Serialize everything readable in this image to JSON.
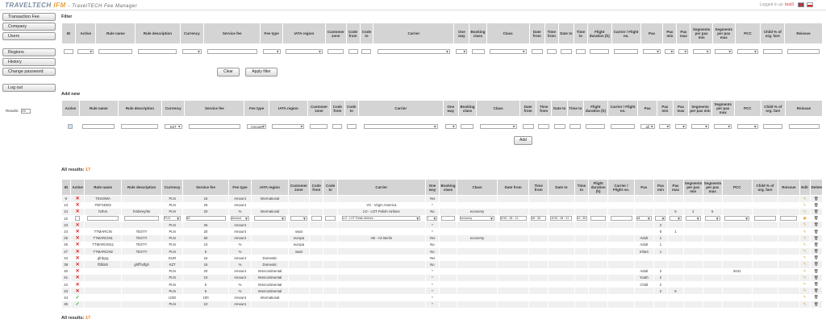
{
  "header": {
    "logo_main": "TRAVELTECH",
    "logo_accent": "IFM",
    "logo_sub": "- TravelTECH Fee Manager",
    "login_label": "Logged in as:",
    "login_user": "test3"
  },
  "sidebar": {
    "items": [
      "Transaction Fee",
      "Company",
      "Users",
      "Regions",
      "History",
      "Change password",
      "Log out"
    ],
    "results_label": "Results:",
    "results_value": "25"
  },
  "filter": {
    "title": "Filter",
    "columns": [
      "ID",
      "Active",
      "Rule name",
      "Rule description",
      "Currency",
      "Service fee",
      "Fee type",
      "IATA region",
      "Customer zone",
      "Code from",
      "Code to",
      "Carrier",
      "One way",
      "Booking class",
      "Class",
      "Date from",
      "Time from",
      "Date to",
      "Time to",
      "Flight duration (h)",
      "Carrier / Flight no.",
      "Pax",
      "Pax min",
      "Pax max",
      "Segments per pax min",
      "Segments per pax max",
      "PCC",
      "Child % of org. fare",
      "Reissue"
    ],
    "clear_label": "Clear",
    "apply_label": "Apply filter"
  },
  "addnew": {
    "title": "Add new",
    "columns": [
      "Active",
      "Rule name",
      "Rule description",
      "Currency",
      "Service fee",
      "Fee type",
      "IATA region",
      "Customer zone",
      "Code from",
      "Code to",
      "Carrier",
      "One way",
      "Booking class",
      "Class",
      "Date from",
      "Time from",
      "Date to",
      "Time to",
      "Flight duration (h)",
      "Carrier / Flight no.",
      "Pax",
      "Pax min",
      "Pax max",
      "Segments per pax min",
      "Segments per pax max",
      "PCC",
      "Child % of org. fare",
      "Reissue"
    ],
    "currency": "KZT",
    "feetype": "Amount",
    "pax": "all",
    "add_label": "Add"
  },
  "results": {
    "label": "All results:",
    "count": "17",
    "columns": [
      "ID",
      "Active",
      "Rule name",
      "Rule description",
      "Currency",
      "Service fee",
      "Fee type",
      "IATA region",
      "Customer zone",
      "Code from",
      "Code to",
      "Carrier",
      "One way",
      "Booking class",
      "Class",
      "Date from",
      "Time from",
      "Date to",
      "Time to",
      "Flight duration (h)",
      "Carrier / Flight no.",
      "Pax",
      "Pax min",
      "Pax max",
      "Segments per pax min",
      "Segments per pax max",
      "PCC",
      "Child % of org. fare",
      "Reissue",
      "Edit",
      "Delete"
    ],
    "rows": [
      {
        "id": "9",
        "active": "x",
        "name": "TESOWA",
        "desc": "",
        "cur": "PLN",
        "fee": "15",
        "type": "Amount",
        "iata": "International",
        "zone": "",
        "carrier": "",
        "oneway": "Yes",
        "cls": "",
        "pax": "",
        "pmin": "",
        "pmax": "",
        "smin": "",
        "smax": "",
        "pcc": ""
      },
      {
        "id": "13",
        "active": "x",
        "name": "FDFSDDS",
        "desc": "",
        "cur": "PLN",
        "fee": "26",
        "type": "Amount",
        "iata": "",
        "zone": "",
        "carrier": "VX - Virgin America",
        "oneway": "*",
        "cls": "",
        "pax": "",
        "pmin": "",
        "pmax": "",
        "smin": "",
        "smax": "",
        "pcc": ""
      },
      {
        "id": "14",
        "active": "x",
        "name": "hrthrs",
        "desc": "hrtdsreyhts",
        "cur": "PLN",
        "fee": "20",
        "type": "%",
        "iata": "International",
        "zone": "",
        "carrier": "LO - LOT Polish Airlines",
        "oneway": "No",
        "cls": "economy",
        "pax": "",
        "pmin": "",
        "pmax": "6",
        "smin": "2",
        "smax": "5",
        "pcc": ""
      },
      {
        "id": "22",
        "edit": true,
        "cur": "PLN",
        "fee": "45",
        "type": "Amount",
        "carrier": "LO - LOT Polish Airlines",
        "oneway": "*",
        "cls": "economy",
        "df": "2015 - 08 - 12",
        "tf": "08 : 35",
        "dt": "2015 - 08 - 31",
        "tt": "12 : 35",
        "pax": "all"
      },
      {
        "id": "23",
        "active": "x",
        "name": "",
        "desc": "",
        "cur": "PLN",
        "fee": "25",
        "type": "Amount",
        "iata": "",
        "zone": "",
        "carrier": "",
        "oneway": "*",
        "cls": "",
        "pax": "",
        "pmin": "2",
        "pmax": "",
        "smin": "",
        "smax": "",
        "pcc": ""
      },
      {
        "id": "24",
        "active": "x",
        "name": "TTMARCIN",
        "desc": "TESTY",
        "cur": "PLN",
        "fee": "20",
        "type": "Amount",
        "iata": "",
        "zone": "swat",
        "carrier": "",
        "oneway": "*",
        "cls": "",
        "pax": "",
        "pmin": "0",
        "pmax": "1",
        "smin": "",
        "smax": "",
        "pcc": ""
      },
      {
        "id": "25",
        "active": "x",
        "name": "TTMARCIN1",
        "desc": "TESTY",
        "cur": "PLN",
        "fee": "50",
        "type": "Amount",
        "iata": "",
        "zone": "europa",
        "carrier": "AB - Air Berlin",
        "oneway": "Yes",
        "cls": "economy",
        "pax": "Adult",
        "pmin": "1",
        "pmax": "",
        "smin": "",
        "smax": "",
        "pcc": ""
      },
      {
        "id": "26",
        "active": "x",
        "name": "TTMARCIN11",
        "desc": "TESTY",
        "cur": "PLN",
        "fee": "10",
        "type": "%",
        "iata": "",
        "zone": "europa",
        "carrier": "",
        "oneway": "No",
        "cls": "",
        "pax": "Adult",
        "pmin": "1",
        "pmax": "",
        "smin": "",
        "smax": "",
        "pcc": ""
      },
      {
        "id": "27",
        "active": "x",
        "name": "TTMARCIN2",
        "desc": "TESTY",
        "cur": "PLN",
        "fee": "6",
        "type": "%",
        "iata": "",
        "zone": "swat",
        "carrier": "",
        "oneway": "No",
        "cls": "",
        "pax": "Infant",
        "pmin": "1",
        "pmax": "",
        "smin": "",
        "smax": "",
        "pcc": ""
      },
      {
        "id": "34",
        "active": "x",
        "name": "gfrdgrg",
        "desc": "",
        "cur": "EUR",
        "fee": "16",
        "type": "Amount",
        "iata": "Domestic",
        "zone": "",
        "carrier": "",
        "oneway": "Yes",
        "cls": "",
        "pax": "",
        "pmin": "",
        "pmax": "",
        "smin": "",
        "smax": "",
        "pcc": ""
      },
      {
        "id": "39",
        "active": "x",
        "name": "ffdfdsh",
        "desc": "ghff'hdfgh",
        "cur": "KZT",
        "fee": "15",
        "type": "%",
        "iata": "Domestic",
        "zone": "",
        "carrier": "",
        "oneway": "No",
        "cls": "",
        "pax": "",
        "pmin": "",
        "pmax": "",
        "smin": "",
        "smax": "",
        "pcc": ""
      },
      {
        "id": "40",
        "active": "x",
        "name": "",
        "desc": "",
        "cur": "PLN",
        "fee": "20",
        "type": "Amount",
        "iata": "Intercontinental",
        "zone": "",
        "carrier": "",
        "oneway": "*",
        "cls": "",
        "pax": "Adult",
        "pmin": "2",
        "pmax": "",
        "smin": "",
        "smax": "",
        "pcc": "3431"
      },
      {
        "id": "41",
        "active": "x",
        "name": "",
        "desc": "",
        "cur": "PLN",
        "fee": "10",
        "type": "Amount",
        "iata": "Intercontinental",
        "zone": "",
        "carrier": "",
        "oneway": "*",
        "cls": "",
        "pax": "Youth",
        "pmin": "2",
        "pmax": "",
        "smin": "",
        "smax": "",
        "pcc": ""
      },
      {
        "id": "42",
        "active": "x",
        "name": "",
        "desc": "",
        "cur": "PLN",
        "fee": "5",
        "type": "%",
        "iata": "Intercontinental",
        "zone": "",
        "carrier": "",
        "oneway": "*",
        "cls": "",
        "pax": "Child",
        "pmin": "2",
        "pmax": "",
        "smin": "",
        "smax": "",
        "pcc": ""
      },
      {
        "id": "43",
        "active": "x",
        "name": "",
        "desc": "",
        "cur": "PLN",
        "fee": "5",
        "type": "%",
        "iata": "Intercontinental",
        "zone": "",
        "carrier": "",
        "oneway": "*",
        "cls": "",
        "pax": "",
        "pmin": "2",
        "pmax": "5",
        "smin": "",
        "smax": "",
        "pcc": ""
      },
      {
        "id": "44",
        "active": "ok",
        "name": "",
        "desc": "",
        "cur": "USD",
        "fee": "100",
        "type": "Amount",
        "iata": "International",
        "zone": "",
        "carrier": "",
        "oneway": "*",
        "cls": "",
        "pax": "",
        "pmin": "",
        "pmax": "",
        "smin": "",
        "smax": "",
        "pcc": ""
      },
      {
        "id": "45",
        "active": "ok",
        "name": "",
        "desc": "",
        "cur": "PLN",
        "fee": "10",
        "type": "Amount",
        "iata": "",
        "zone": "",
        "carrier": "",
        "oneway": "*",
        "cls": "",
        "pax": "",
        "pmin": "",
        "pmax": "",
        "smin": "",
        "smax": "",
        "pcc": ""
      }
    ]
  },
  "bottom": {
    "label": "All results:",
    "count": "17"
  }
}
